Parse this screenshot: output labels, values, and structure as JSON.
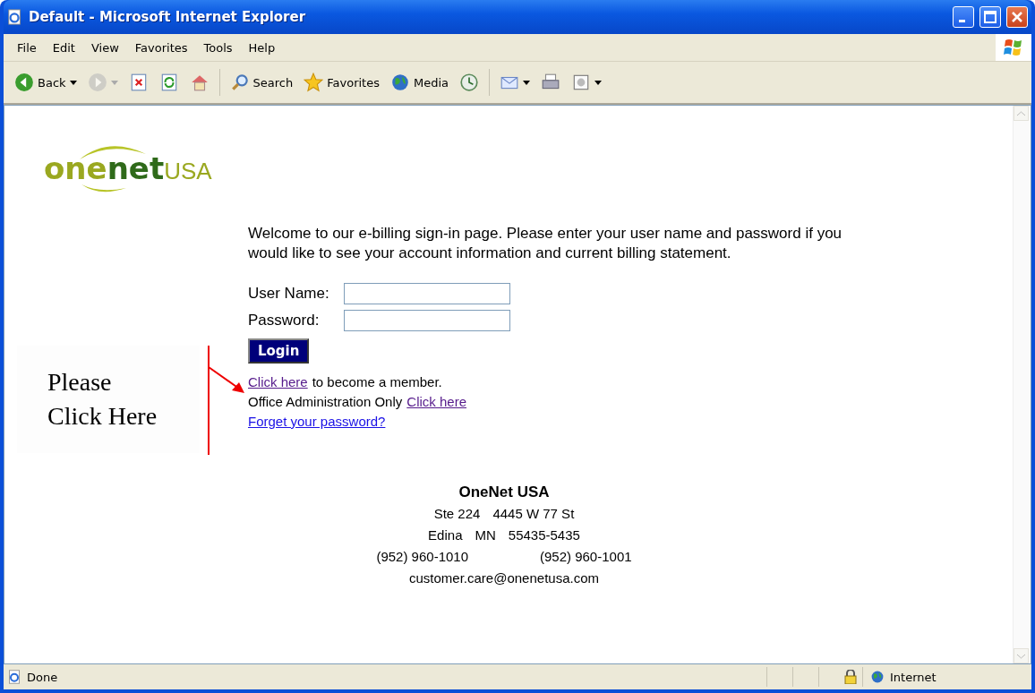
{
  "window": {
    "title": "Default - Microsoft Internet Explorer"
  },
  "menu": [
    "File",
    "Edit",
    "View",
    "Favorites",
    "Tools",
    "Help"
  ],
  "toolbar": [
    {
      "kind": "back",
      "label": "Back",
      "dropdown": true,
      "disabled": false
    },
    {
      "kind": "forward",
      "dropdown": true,
      "disabled": true
    },
    {
      "kind": "stop",
      "dropdown": false,
      "disabled": false
    },
    {
      "kind": "refresh",
      "dropdown": false,
      "disabled": false
    },
    {
      "kind": "home",
      "dropdown": false,
      "disabled": false
    },
    {
      "kind": "search",
      "label": "Search",
      "dropdown": false,
      "disabled": false
    },
    {
      "kind": "favorites",
      "label": "Favorites",
      "dropdown": false,
      "disabled": false
    },
    {
      "kind": "media",
      "label": "Media",
      "dropdown": false,
      "disabled": false
    },
    {
      "kind": "history",
      "dropdown": false,
      "disabled": false
    },
    {
      "kind": "mail",
      "dropdown": true,
      "disabled": false
    },
    {
      "kind": "print",
      "dropdown": false,
      "disabled": false
    },
    {
      "kind": "edit",
      "dropdown": true,
      "disabled": false
    }
  ],
  "page": {
    "logo": {
      "light": "one",
      "bold": "net",
      "suffix": "USA"
    },
    "intro": "Welcome to our e-billing sign-in page. Please enter your user name and password if you would like to see your account information and current billing statement.",
    "fields": [
      {
        "label": "User Name:"
      },
      {
        "label": "Password:"
      }
    ],
    "login_button": "Login",
    "link_lines": [
      [
        {
          "kind": "link",
          "text": "Click here",
          "visited": true
        },
        {
          "kind": "text",
          "text": "to become a member."
        }
      ],
      [
        {
          "kind": "text",
          "text": "Office Administration Only"
        },
        {
          "kind": "link",
          "text": "Click here",
          "visited": true
        }
      ],
      [
        {
          "kind": "link",
          "text": "Forget your password?",
          "visited": false
        }
      ]
    ],
    "address": {
      "name": "OneNet USA",
      "lines": [
        [
          "Ste 224",
          "4445 W 77 St"
        ],
        [
          "Edina",
          "MN",
          "55435-5435"
        ],
        [
          "(952) 960-1010",
          "(952) 960-1001"
        ],
        [
          "customer.care@onenetusa.com"
        ]
      ]
    },
    "callout": {
      "lines": [
        "Please",
        "Click Here"
      ]
    }
  },
  "status_bar": {
    "text": "Done",
    "zone": "Internet"
  }
}
